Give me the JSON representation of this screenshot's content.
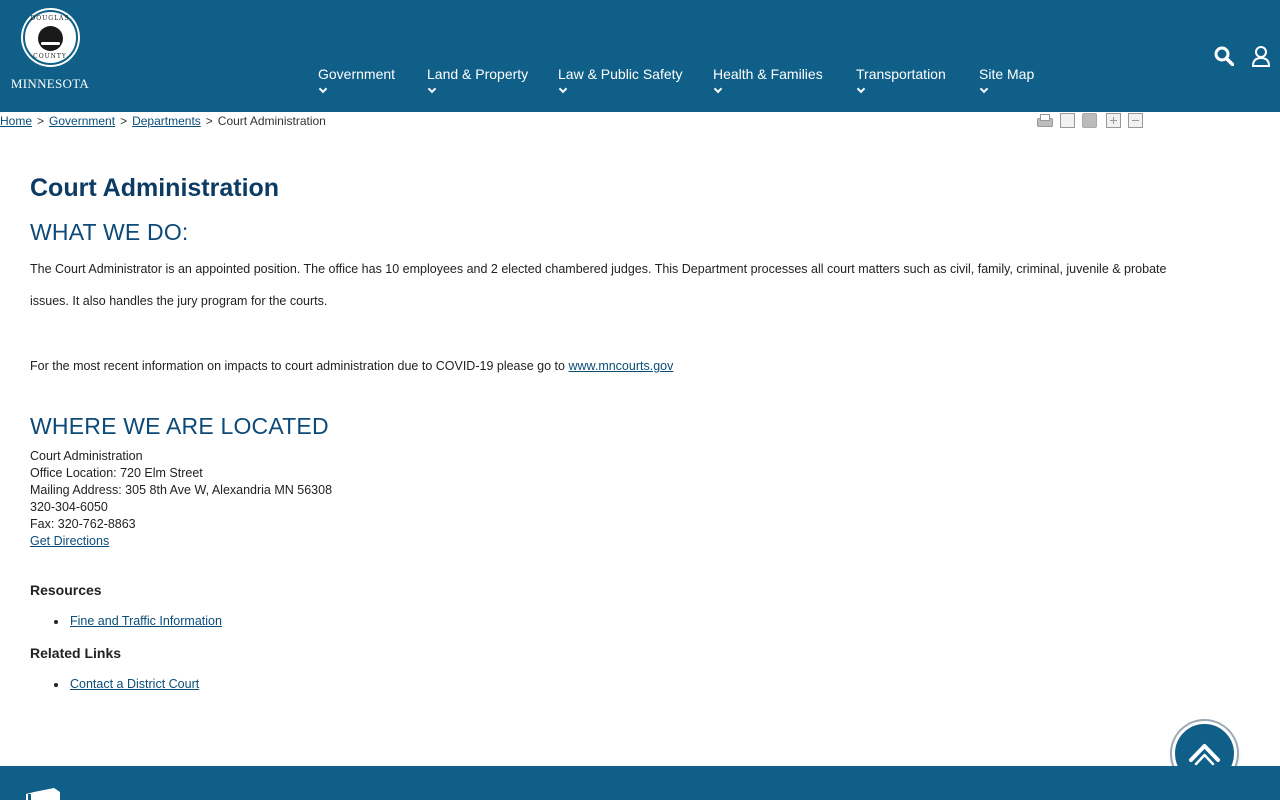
{
  "header": {
    "logo": {
      "seal_top": "DOUGLAS",
      "seal_bottom": "COUNTY",
      "state": "MINNESOTA"
    },
    "nav": [
      {
        "label": "Government"
      },
      {
        "label": "Land & Property"
      },
      {
        "label": "Law & Public Safety"
      },
      {
        "label": "Health & Families"
      },
      {
        "label": "Transportation"
      },
      {
        "label": "Site Map"
      }
    ],
    "icons": {
      "search": "search-icon",
      "user": "user-icon"
    }
  },
  "breadcrumb": {
    "items": [
      "Home",
      "Government",
      "Departments"
    ],
    "current": "Court Administration",
    "separator": ">"
  },
  "tools": [
    "print-icon",
    "email-icon",
    "rss-icon",
    "zoom-in-icon",
    "zoom-out-icon"
  ],
  "main": {
    "title": "Court Administration",
    "what_heading": "WHAT WE DO:",
    "what_line1": "The Court Administrator is an appointed position.  The office has 10 employees and 2 elected chambered judges. This Department processes all court matters such as civil, family, criminal, juvenile & probate",
    "what_line2": "issues. It also handles the jury program for the courts.",
    "covid_text": "For the most recent information on impacts to court administration due to COVID-19 please go to ",
    "covid_link": "www.mncourts.gov",
    "where_heading": "WHERE WE ARE LOCATED",
    "address": {
      "name": "Court Administration",
      "office": "Office Location: 720 Elm Street",
      "mailing": "Mailing Address: 305 8th Ave W, Alexandria MN 56308",
      "phone": "320-304-6050",
      "fax": "Fax: 320-762-8863",
      "directions": "Get Directions"
    },
    "resources_heading": "Resources",
    "resources": [
      "Fine and Traffic Information"
    ],
    "related_heading": "Related Links",
    "related": [
      "Contact a District Court"
    ]
  },
  "colors": {
    "header_bg": "#0f5f88",
    "title": "#0c3b63",
    "link": "#0a4d7a"
  }
}
